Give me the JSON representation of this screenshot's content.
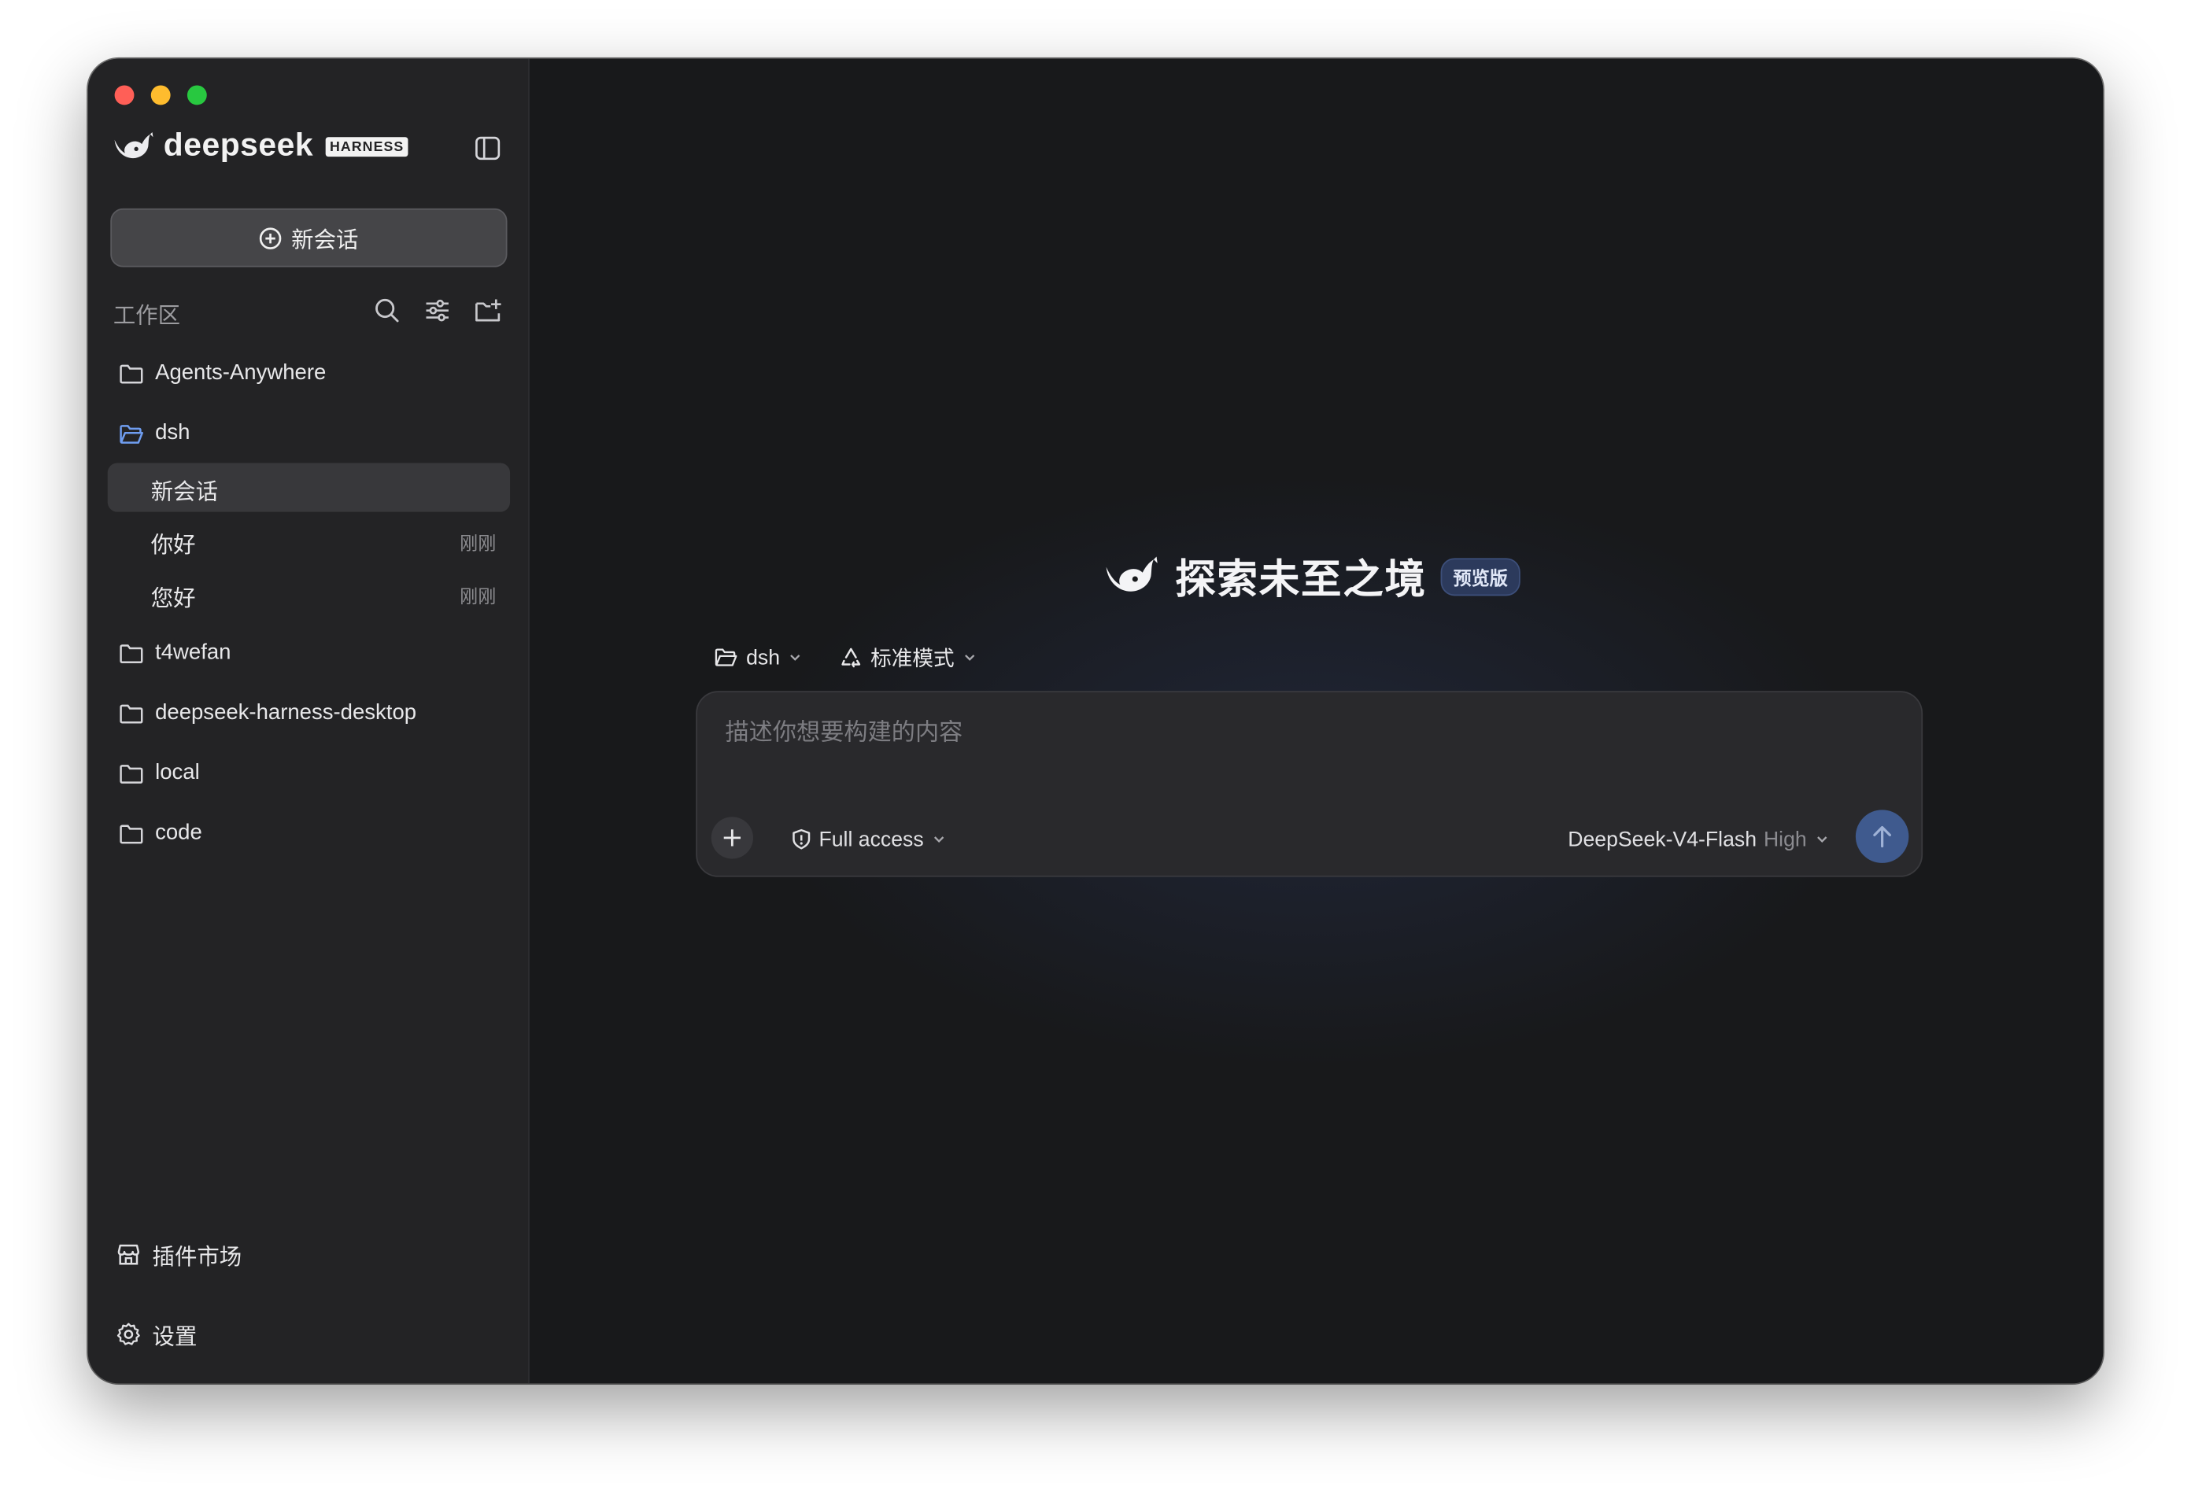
{
  "window": {
    "traffic_lights": [
      "close",
      "minimize",
      "zoom"
    ]
  },
  "sidebar": {
    "brand": {
      "name": "deepseek",
      "badge": "HARNESS",
      "logo_icon": "whale-logo-icon",
      "toggle_icon": "sidebar-toggle-icon"
    },
    "new_chat_label": "新会话",
    "workspace_label": "工作区",
    "workspace_tools": [
      "search-icon",
      "filter-sliders-icon",
      "new-folder-icon"
    ],
    "projects": [
      {
        "name": "Agents-Anywhere",
        "expanded": false
      },
      {
        "name": "dsh",
        "expanded": true,
        "chats": [
          {
            "title": "新会话",
            "time": "",
            "active": true
          },
          {
            "title": "你好",
            "time": "刚刚",
            "active": false
          },
          {
            "title": "您好",
            "time": "刚刚",
            "active": false
          }
        ]
      },
      {
        "name": "t4wefan",
        "expanded": false
      },
      {
        "name": "deepseek-harness-desktop",
        "expanded": false
      },
      {
        "name": "local",
        "expanded": false
      },
      {
        "name": "code",
        "expanded": false
      }
    ],
    "footer": {
      "plugins_label": "插件市场",
      "settings_label": "设置"
    }
  },
  "main": {
    "hero": {
      "title": "探索未至之境",
      "badge": "预览版"
    },
    "context": {
      "folder": "dsh",
      "mode": "标准模式"
    },
    "composer": {
      "placeholder": "描述你想要构建的内容",
      "value": "",
      "access_label": "Full access",
      "model_name": "DeepSeek-V4-Flash",
      "model_effort": "High"
    }
  },
  "colors": {
    "window_bg": "#18191b",
    "sidebar_bg": "#232325",
    "active_row": "#38383b",
    "accent_blue": "#3f5a8e",
    "badge_bg": "#2c3a5c",
    "folder_open_blue": "#6f9df0"
  }
}
